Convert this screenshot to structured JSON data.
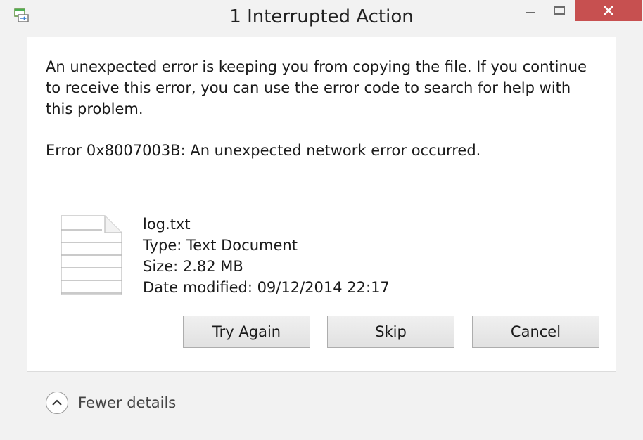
{
  "window": {
    "title": "1 Interrupted Action"
  },
  "message": {
    "body": "An unexpected error is keeping you from copying the file. If you continue to receive this error, you can use the error code to search for help with this problem.",
    "error": "Error 0x8007003B: An unexpected network error occurred."
  },
  "file": {
    "icon": "text-file-icon",
    "name": "log.txt",
    "type": "Type: Text Document",
    "size": "Size: 2.82 MB",
    "date": "Date modified: 09/12/2014 22:17"
  },
  "buttons": {
    "try_again": "Try Again",
    "skip": "Skip",
    "cancel": "Cancel"
  },
  "footer": {
    "details_label": "Fewer details",
    "details_icon": "chevron-up-icon"
  },
  "colors": {
    "close_button": "#c75050",
    "chrome": "#f2f2f2",
    "panel": "#ffffff"
  }
}
